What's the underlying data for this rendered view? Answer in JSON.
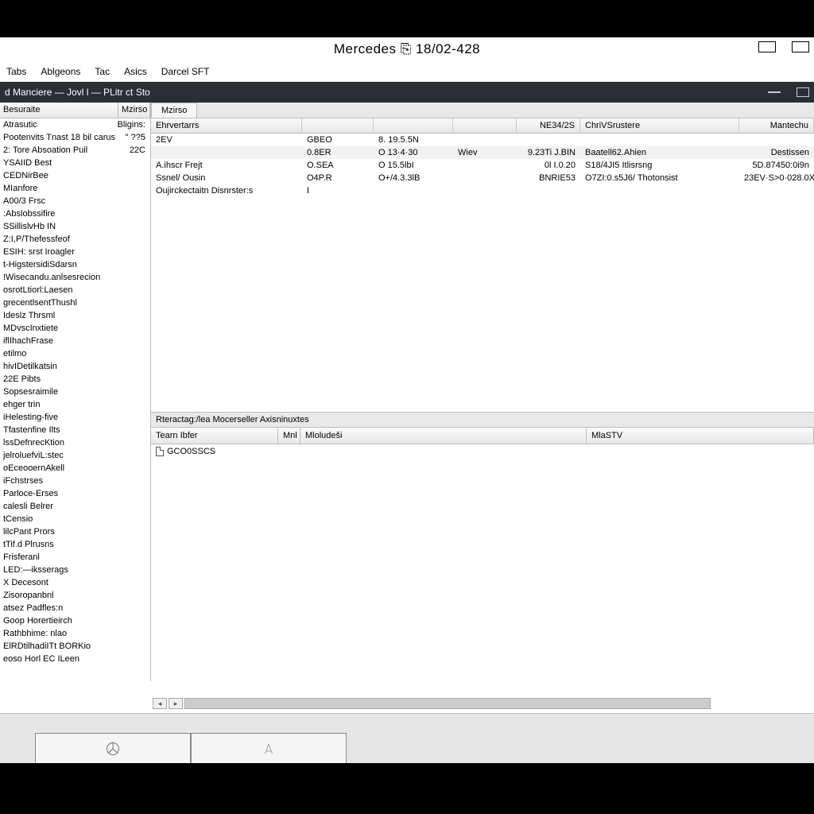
{
  "title": "Mercedes  ⎘ 18/02-428",
  "menu": [
    "Tabs",
    "Ablgeons",
    "Tac",
    "Asics",
    "Darcel SFT"
  ],
  "subheader": "d Manciere  —  Jovl l  —  PLitr ct Sto",
  "sidebar_headers": {
    "a": "Besuraite",
    "b": "Mzirso"
  },
  "sidebar": [
    {
      "n": "Atrasutic",
      "v": "Bligins:"
    },
    {
      "n": "Pootenvits Tnast 18 bil carus",
      "v": "\" ??5"
    },
    {
      "n": "2: Tore Absoation Puil",
      "v": "22C"
    },
    {
      "n": "YSAIID Best",
      "v": ""
    },
    {
      "n": "CEDNirBee",
      "v": ""
    },
    {
      "n": "MIanfore",
      "v": ""
    },
    {
      "n": "A00/3 Frsc",
      "v": ""
    },
    {
      "n": ":Abslobssifire",
      "v": ""
    },
    {
      "n": "SSillislvHb IN",
      "v": ""
    },
    {
      "n": "Z:I,P/Thefessfeof",
      "v": ""
    },
    {
      "n": "ESIH: srst Iroagler",
      "v": ""
    },
    {
      "n": "t-HigstersidiSdarsn",
      "v": ""
    },
    {
      "n": "!Wisecandu.anlsesrecion",
      "v": ""
    },
    {
      "n": "osrotLtiorl:Laesen",
      "v": ""
    },
    {
      "n": "grecentlsentThushl",
      "v": ""
    },
    {
      "n": "Ideslz  Thrsml",
      "v": ""
    },
    {
      "n": "MDvscInxtiete",
      "v": ""
    },
    {
      "n": "iflIhachFrase",
      "v": ""
    },
    {
      "n": "etilmo",
      "v": ""
    },
    {
      "n": "hivIDetilkatsin",
      "v": ""
    },
    {
      "n": "22E Pibts",
      "v": ""
    },
    {
      "n": "Sopsesraimile",
      "v": ""
    },
    {
      "n": "ehger trin",
      "v": ""
    },
    {
      "n": "iHelesting-five",
      "v": ""
    },
    {
      "n": "Tfastenfine Ilts",
      "v": ""
    },
    {
      "n": "lssDefnrecKtion",
      "v": ""
    },
    {
      "n": "jelroluefviL:stec",
      "v": ""
    },
    {
      "n": "oEceooernAkell",
      "v": ""
    },
    {
      "n": "iFchstrses",
      "v": ""
    },
    {
      "n": "Parloce-Erses",
      "v": ""
    },
    {
      "n": "calesli  Belrer",
      "v": ""
    },
    {
      "n": "tCensio",
      "v": ""
    },
    {
      "n": "lilcPant Prors",
      "v": ""
    },
    {
      "n": "tTif.d Plrusns",
      "v": ""
    },
    {
      "n": "Frisferanl",
      "v": ""
    },
    {
      "n": "LED:—iksserags",
      "v": ""
    },
    {
      "n": "X Decesont",
      "v": ""
    },
    {
      "n": "Zisoropanbnl",
      "v": ""
    },
    {
      "n": "atsez Padfles:n",
      "v": ""
    },
    {
      "n": "Goop Horertieirch",
      "v": ""
    },
    {
      "n": "Rathbhime: nlao",
      "v": ""
    },
    {
      "n": "ElRDtilhadiITt BORKio",
      "v": ""
    },
    {
      "n": "eoso Horl EC  ILeen",
      "v": ""
    }
  ],
  "tab_active": "Mzirso",
  "grid_headers": [
    "Ehrvertarrs",
    "",
    "",
    "",
    "NE34/2S",
    "ChriVSrustere",
    "Mantechu"
  ],
  "grid_rows": [
    {
      "c": [
        "2EV",
        "GBEO",
        "8. 19.5.5N",
        "",
        "",
        "",
        ""
      ],
      "sel": false
    },
    {
      "c": [
        "",
        "0.8ER",
        "O 13·4·30",
        "Wiev",
        "9.23Ti J.BIN",
        "Baatell62.Ahien",
        "Destissen"
      ],
      "sel": true
    },
    {
      "c": [
        "A.ihscr Frejt",
        "O.SEA",
        "O  15.5lbI",
        "",
        "0l I.0.20",
        "S18/4JI5 Itlisrsng",
        "5D.87450:0i9n"
      ],
      "sel": false
    },
    {
      "c": [
        "Ssnel/ Ousin",
        "O4P.R",
        "O+/4.3.3lB",
        "",
        "BNRIE53",
        "O7ZI:0.s5J6/ Thotonsist",
        "23EV·S>0·028.0X"
      ],
      "sel": false
    },
    {
      "c": [
        "Oujirckectaitn Disnrster:s",
        "I",
        "",
        "",
        "",
        "",
        ""
      ],
      "sel": false
    }
  ],
  "lower_title": "Rteractag:/lea Mocerseller    Axisninuxtes",
  "lower_headers": [
    "Tearn Ibfer",
    "Mnl",
    "Mloludeši",
    "MlaSTV"
  ],
  "lower_rows": [
    {
      "c": [
        "GCO0SSCS",
        "",
        "",
        ""
      ]
    }
  ]
}
